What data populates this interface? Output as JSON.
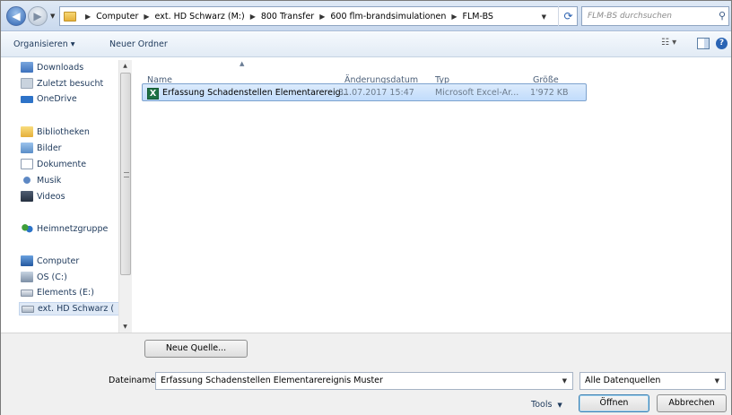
{
  "address": {
    "breadcrumbs": [
      "Computer",
      "ext. HD Schwarz (M:)",
      "800 Transfer",
      "600 flm-brandsimulationen",
      "FLM-BS"
    ],
    "search_placeholder": "FLM-BS durchsuchen"
  },
  "toolbar": {
    "organize_label": "Organisieren ▾",
    "new_folder_label": "Neuer Ordner"
  },
  "nav": {
    "items": [
      {
        "label": "Downloads",
        "icon": "downloads-icon"
      },
      {
        "label": "Zuletzt besucht",
        "icon": "recent-places-icon"
      },
      {
        "label": "OneDrive",
        "icon": "onedrive-icon"
      },
      {
        "label": "Bibliotheken",
        "icon": "libraries-icon"
      },
      {
        "label": "Bilder",
        "icon": "pictures-icon"
      },
      {
        "label": "Dokumente",
        "icon": "documents-icon"
      },
      {
        "label": "Musik",
        "icon": "music-icon"
      },
      {
        "label": "Videos",
        "icon": "videos-icon"
      },
      {
        "label": "Heimnetzgruppe",
        "icon": "homegroup-icon"
      },
      {
        "label": "Computer",
        "icon": "computer-icon"
      },
      {
        "label": "OS (C:)",
        "icon": "os-drive-icon"
      },
      {
        "label": "Elements (E:)",
        "icon": "drive-icon"
      },
      {
        "label": "ext. HD Schwarz (",
        "icon": "drive-icon"
      }
    ]
  },
  "files": {
    "columns": {
      "name": "Name",
      "date": "Änderungsdatum",
      "type": "Typ",
      "size": "Größe"
    },
    "rows": [
      {
        "name": "Erfassung Schadenstellen Elementarereig...",
        "date": "31.07.2017 15:47",
        "type": "Microsoft Excel-Ar...",
        "size": "1'972 KB"
      }
    ]
  },
  "footer": {
    "new_source_label": "Neue Quelle...",
    "filename_label": "Dateiname:",
    "filename_value": "Erfassung Schadenstellen Elementarereignis Muster",
    "filter_value": "Alle Datenquellen",
    "tools_label": "Tools",
    "open_label": "Öffnen",
    "cancel_label": "Abbrechen"
  },
  "colors": {
    "selection_bg": "#cce4fc",
    "selection_border": "#7da2ce",
    "excel_green": "#1e7145"
  }
}
